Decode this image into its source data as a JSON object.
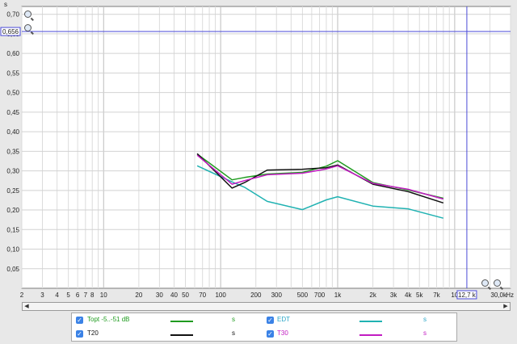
{
  "chart_data": {
    "type": "line",
    "xscale": "log",
    "xlim": [
      2,
      30000
    ],
    "ylim": [
      0,
      0.72
    ],
    "ylabel": "s",
    "xunit": "Hz",
    "grid": true,
    "y_ticks": [
      "0,05",
      "0,10",
      "0,15",
      "0,20",
      "0,25",
      "0,30",
      "0,35",
      "0,40",
      "0,45",
      "0,50",
      "0,55",
      "0,60",
      "0,65",
      "0,70"
    ],
    "x_ticks": [
      {
        "v": 2,
        "t": "2"
      },
      {
        "v": 3,
        "t": "3"
      },
      {
        "v": 4,
        "t": "4"
      },
      {
        "v": 5,
        "t": "5"
      },
      {
        "v": 6,
        "t": "6"
      },
      {
        "v": 7,
        "t": "7"
      },
      {
        "v": 8,
        "t": "8"
      },
      {
        "v": 10,
        "t": "10"
      },
      {
        "v": 20,
        "t": "20"
      },
      {
        "v": 30,
        "t": "30"
      },
      {
        "v": 40,
        "t": "40"
      },
      {
        "v": 50,
        "t": "50"
      },
      {
        "v": 70,
        "t": "70"
      },
      {
        "v": 100,
        "t": "100"
      },
      {
        "v": 200,
        "t": "200"
      },
      {
        "v": 300,
        "t": "300"
      },
      {
        "v": 500,
        "t": "500"
      },
      {
        "v": 700,
        "t": "700"
      },
      {
        "v": 1000,
        "t": "1k"
      },
      {
        "v": 2000,
        "t": "2k"
      },
      {
        "v": 3000,
        "t": "3k"
      },
      {
        "v": 4000,
        "t": "4k"
      },
      {
        "v": 5000,
        "t": "5k"
      },
      {
        "v": 7000,
        "t": "7k"
      },
      {
        "v": 10000,
        "t": "10"
      },
      {
        "v": 30000,
        "t": "30,0k"
      }
    ],
    "x": [
      63,
      125,
      160,
      250,
      500,
      800,
      1000,
      2000,
      4000,
      8000
    ],
    "series": [
      {
        "name": "Topt -5..-51 dB",
        "color": "#1f9b1f",
        "values": [
          0.343,
          0.277,
          0.283,
          0.292,
          0.296,
          0.312,
          0.326,
          0.27,
          0.251,
          0.23
        ]
      },
      {
        "name": "EDT",
        "color": "#20b2b2",
        "values": [
          0.313,
          0.272,
          0.258,
          0.222,
          0.201,
          0.226,
          0.234,
          0.21,
          0.203,
          0.179
        ]
      },
      {
        "name": "T20",
        "color": "#111111",
        "values": [
          0.344,
          0.256,
          0.27,
          0.302,
          0.304,
          0.308,
          0.315,
          0.266,
          0.247,
          0.218
        ]
      },
      {
        "name": "T30",
        "color": "#c21cc2",
        "values": [
          0.34,
          0.266,
          0.275,
          0.29,
          0.294,
          0.305,
          0.313,
          0.268,
          0.253,
          0.228
        ]
      }
    ],
    "cursor": {
      "y_value": 0.656,
      "y_label": "0,656",
      "x_value": 12700,
      "x_label": "12,7 k"
    }
  },
  "legend": [
    {
      "name": "Topt -5..-51 dB",
      "unit": "s",
      "color": "#1f9b1f",
      "label_color": "#1f9b1f",
      "unit_color": "#1f9b1f"
    },
    {
      "name": "EDT",
      "unit": "s",
      "color": "#20b2b2",
      "label_color": "#2aa6c8",
      "unit_color": "#2aa6c8"
    },
    {
      "name": "T20",
      "unit": "s",
      "color": "#111111",
      "label_color": "#111111",
      "unit_color": "#111111"
    },
    {
      "name": "T30",
      "unit": "s",
      "color": "#c21cc2",
      "label_color": "#c21cc2",
      "unit_color": "#c21cc2"
    }
  ],
  "icons": [
    "zoom-in-icon",
    "zoom-out-icon",
    "checkbox-checked-icon",
    "scroll-left-icon",
    "scroll-right-icon"
  ]
}
